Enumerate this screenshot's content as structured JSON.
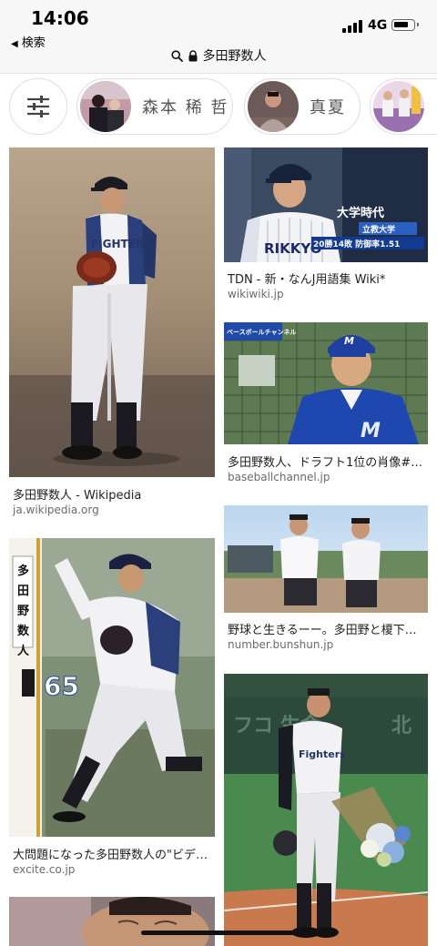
{
  "status": {
    "time": "14:06",
    "back_label": "検索",
    "network": "4G"
  },
  "url": {
    "query": "多田野数人"
  },
  "chips": [
    {
      "label": "森本 稀 哲"
    },
    {
      "label": "真夏"
    }
  ],
  "results": [
    {
      "title": "多田野数人 - Wikipedia",
      "source": "ja.wikipedia.org"
    },
    {
      "title": "TDN - 新・なんJ用語集 Wiki*",
      "source": "wikiwiki.jp"
    },
    {
      "title": "多田野数人、ドラフト1位の肖像#…",
      "source": "baseballchannel.jp"
    },
    {
      "title": "野球と生きるーー。多田野と榎下…",
      "source": "number.bunshun.jp"
    },
    {
      "title": "大問題になった多田野数人の\"ビデ…",
      "source": "excite.co.jp"
    }
  ],
  "image_text": {
    "card2_caption": "大学時代",
    "card2_school": "立教大学",
    "card2_stats": "20勝14敗 防御率1.51",
    "card4_name": "多田野数人",
    "card4_number": "65",
    "card3_channel": "ベースボールチャンネル"
  },
  "colors": {
    "accent": "#1a4b9c",
    "text": "#222222",
    "source": "#6b6b6b"
  }
}
